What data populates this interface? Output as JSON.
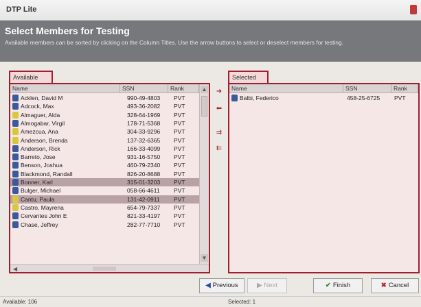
{
  "window": {
    "title": "DTP Lite"
  },
  "header": {
    "title": "Select Members for Testing",
    "description": "Available members can be sorted by clicking on the Column Titles. Use the arrow buttons to select or deselect members for testing."
  },
  "available": {
    "tab_label": "Available",
    "columns": [
      "Name",
      "SSN",
      "Rank"
    ],
    "rows": [
      {
        "name": "Acklen, David M",
        "ssn": "990-49-4803",
        "rank": "PVT",
        "icon": "person-icon",
        "color": "#3b5a9a",
        "selected": false
      },
      {
        "name": "Adcock, Max",
        "ssn": "493-36-2082",
        "rank": "PVT",
        "icon": "person-icon",
        "color": "#3b5a9a",
        "selected": false
      },
      {
        "name": "Almaguer, Alda",
        "ssn": "328-64-1969",
        "rank": "PVT",
        "icon": "person-icon",
        "color": "#d8c840",
        "selected": false
      },
      {
        "name": "Almogabar, Virgil",
        "ssn": "178-71-5368",
        "rank": "PVT",
        "icon": "person-icon",
        "color": "#3b5a9a",
        "selected": false
      },
      {
        "name": "Amezcua, Ana",
        "ssn": "304-33-9296",
        "rank": "PVT",
        "icon": "person-icon",
        "color": "#d8c840",
        "selected": false
      },
      {
        "name": "Anderson, Brenda",
        "ssn": "137-32-6365",
        "rank": "PVT",
        "icon": "person-icon",
        "color": "#d8c840",
        "selected": false
      },
      {
        "name": "Anderson, Rick",
        "ssn": "166-33-4099",
        "rank": "PVT",
        "icon": "person-icon",
        "color": "#3b5a9a",
        "selected": false
      },
      {
        "name": "Barreto, Jose",
        "ssn": "931-16-5750",
        "rank": "PVT",
        "icon": "person-icon",
        "color": "#3b5a9a",
        "selected": false
      },
      {
        "name": "Benson, Joshua",
        "ssn": "460-79-2340",
        "rank": "PVT",
        "icon": "person-icon",
        "color": "#3b5a9a",
        "selected": false
      },
      {
        "name": "Blackmond, Randall",
        "ssn": "826-20-8688",
        "rank": "PVT",
        "icon": "person-icon",
        "color": "#3b5a9a",
        "selected": false
      },
      {
        "name": "Bonner, Karl",
        "ssn": "315-01-3203",
        "rank": "PVT",
        "icon": "person-icon",
        "color": "#3b5a9a",
        "selected": true
      },
      {
        "name": "Bulger, Michael",
        "ssn": "058-66-4611",
        "rank": "PVT",
        "icon": "person-icon",
        "color": "#3b5a9a",
        "selected": false
      },
      {
        "name": "Cantu, Paula",
        "ssn": "131-42-0911",
        "rank": "PVT",
        "icon": "person-icon",
        "color": "#d8c840",
        "selected": true
      },
      {
        "name": "Castro, Mayrena",
        "ssn": "654-79-7337",
        "rank": "PVT",
        "icon": "person-icon",
        "color": "#d8c840",
        "selected": false
      },
      {
        "name": "Cervantes John E",
        "ssn": "821-33-4197",
        "rank": "PVT",
        "icon": "person-icon",
        "color": "#3b5a9a",
        "selected": false
      },
      {
        "name": "Chase, Jeffrey",
        "ssn": "282-77-7710",
        "rank": "PVT",
        "icon": "person-icon",
        "color": "#3b5a9a",
        "selected": false
      }
    ]
  },
  "selected": {
    "tab_label": "Selected",
    "columns": [
      "Name",
      "SSN",
      "Rank"
    ],
    "rows": [
      {
        "name": "Balbi, Federico",
        "ssn": "458-25-6725",
        "rank": "PVT",
        "icon": "person-icon",
        "color": "#3b5a9a"
      }
    ]
  },
  "arrows": [
    {
      "name": "move-right-icon",
      "glyph": "➜"
    },
    {
      "name": "move-left-icon",
      "glyph": "⬅"
    },
    {
      "name": "move-all-right-icon",
      "glyph": "⇉"
    },
    {
      "name": "move-all-left-icon",
      "glyph": "⇇"
    }
  ],
  "buttons": {
    "previous": "Previous",
    "next": "Next",
    "finish": "Finish",
    "cancel": "Cancel"
  },
  "status": {
    "available": "Available: 106",
    "selected": "Selected: 1"
  },
  "colors": {
    "accent": "#a01e2e",
    "panel_bg": "#f6e7e7",
    "header_bg": "#76787c",
    "selected_row": "#b8a2a6"
  }
}
